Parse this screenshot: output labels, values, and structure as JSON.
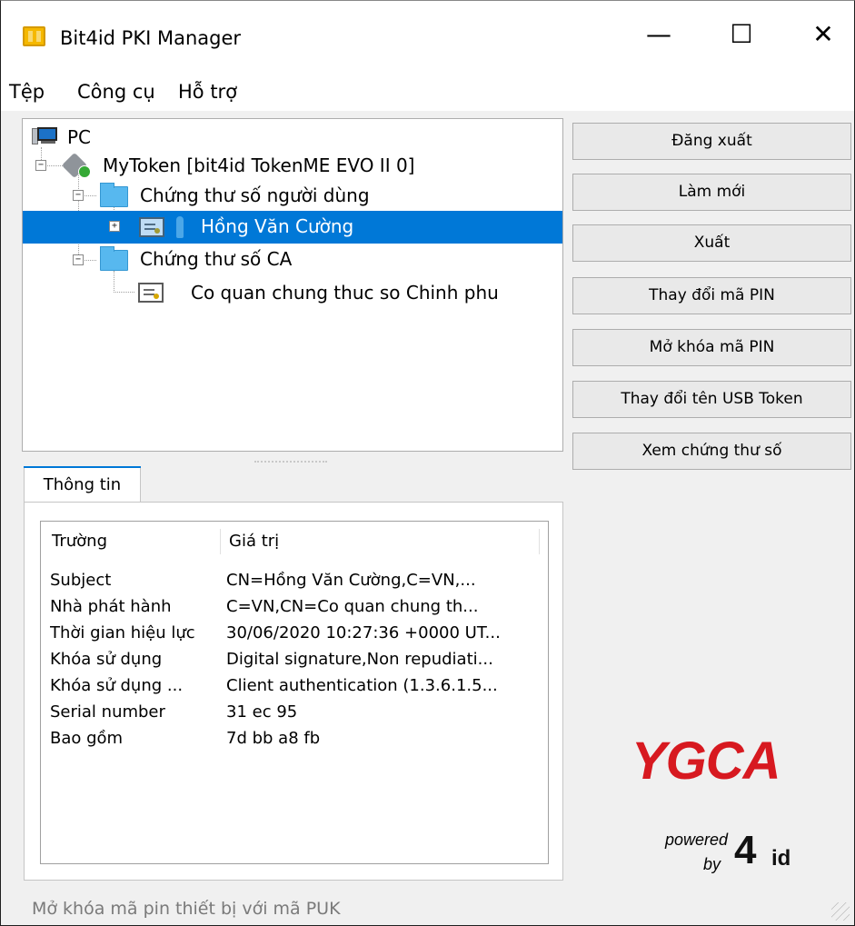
{
  "window": {
    "title": "Bit4id PKI Manager",
    "controls": {
      "minimize": "—",
      "maximize": "☐",
      "close": "✕"
    }
  },
  "menu": [
    "Tệp",
    "Công cụ",
    "Hỗ trợ"
  ],
  "tree": {
    "root": "PC",
    "token": "MyToken [bit4id TokenME EVO II 0]",
    "user_cert_folder": "Chứng thư số người dùng",
    "selected_cert": "Hồng Văn Cường",
    "ca_folder": "Chứng thư số CA",
    "ca_cert": "Co quan chung thuc so Chinh phu"
  },
  "actions": [
    "Đăng xuất",
    "Làm mới",
    "Xuất",
    "Thay đổi mã PIN",
    "Mở khóa mã PIN",
    "Thay đổi tên USB Token",
    "Xem chứng thư số"
  ],
  "details": {
    "tab": "Thông tin",
    "headers": [
      "Trường",
      "Giá trị"
    ],
    "rows": [
      {
        "field": "Subject",
        "value": "CN=Hồng Văn Cường,C=VN,..."
      },
      {
        "field": "Nhà phát hành",
        "value": "C=VN,CN=Co quan chung th..."
      },
      {
        "field": "Thời gian hiệu lực",
        "value": "30/06/2020 10:27:36 +0000 UT..."
      },
      {
        "field": "Khóa sử dụng",
        "value": "Digital signature,Non repudiati..."
      },
      {
        "field": "Khóa sử dụng ...",
        "value": "Client authentication (1.3.6.1.5..."
      },
      {
        "field": "Serial number",
        "value": "31 ec 95"
      },
      {
        "field": "Bao gồm",
        "value": "7d bb a8 fb"
      }
    ]
  },
  "branding": {
    "ygca": "YGCA",
    "powered": "powered",
    "by": "by",
    "brand": "4id"
  },
  "status": "Mở khóa mã pin thiết bị với mã PUK",
  "colors": {
    "selection": "#0078d7",
    "brand_red": "#d71920",
    "button": "#e9e9e9"
  },
  "icons": [
    "application-icon",
    "computer-icon",
    "token-icon",
    "folder-icon",
    "certificate-icon",
    "key-icon"
  ]
}
